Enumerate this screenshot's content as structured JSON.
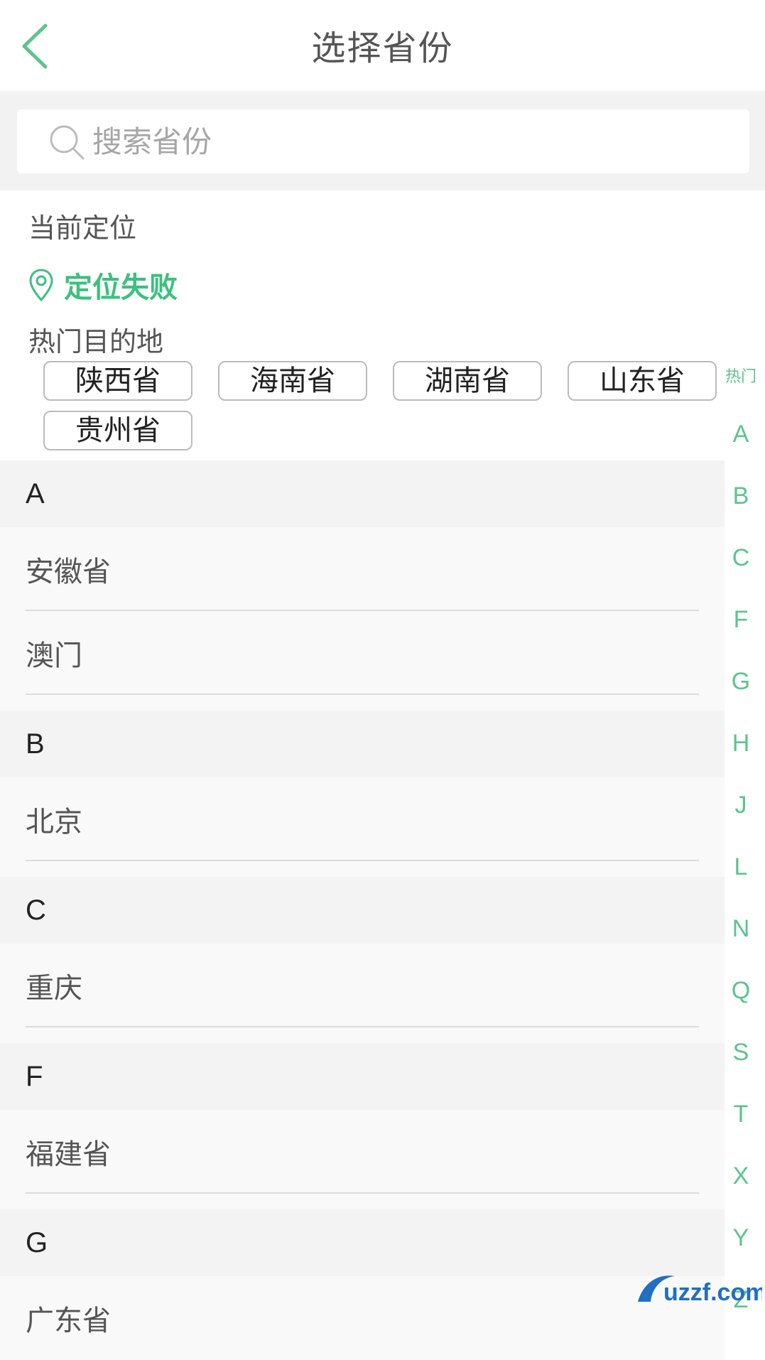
{
  "header": {
    "title": "选择省份"
  },
  "search": {
    "placeholder": "搜索省份"
  },
  "location": {
    "section_label": "当前定位",
    "status": "定位失败"
  },
  "hot": {
    "section_label": "热门目的地",
    "items": [
      "陕西省",
      "海南省",
      "湖南省",
      "山东省",
      "贵州省"
    ]
  },
  "groups": [
    {
      "letter": "A",
      "items": [
        "安徽省",
        "澳门"
      ]
    },
    {
      "letter": "B",
      "items": [
        "北京"
      ]
    },
    {
      "letter": "C",
      "items": [
        "重庆"
      ]
    },
    {
      "letter": "F",
      "items": [
        "福建省"
      ]
    },
    {
      "letter": "G",
      "items": [
        "广东省"
      ]
    }
  ],
  "index_bar": [
    "热门",
    "A",
    "B",
    "C",
    "F",
    "G",
    "H",
    "J",
    "L",
    "N",
    "Q",
    "S",
    "T",
    "X",
    "Y",
    "Z"
  ],
  "colors": {
    "accent": "#3cc07f",
    "index": "#5cc48e",
    "group_bg": "#f3f3f3",
    "row_bg": "#f9f9f9"
  },
  "watermark": {
    "text": "uzzf.com"
  }
}
